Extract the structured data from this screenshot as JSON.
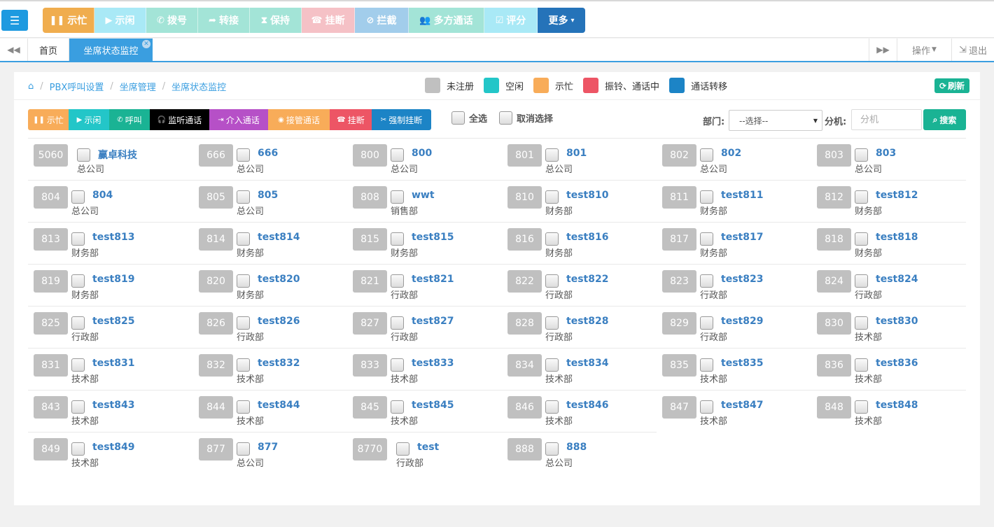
{
  "toolbar": {
    "buttons": [
      {
        "icon": "pause-icon",
        "glyph": "❚❚",
        "label": "示忙",
        "color": "#f0ad4e"
      },
      {
        "icon": "play-icon",
        "glyph": "▶",
        "label": "示闲",
        "color": "#a9e9f6"
      },
      {
        "icon": "phone-icon",
        "glyph": "✆",
        "label": "拨号",
        "color": "#a3e4d7"
      },
      {
        "icon": "share-icon",
        "glyph": "➦",
        "label": "转接",
        "color": "#a3e4d7"
      },
      {
        "icon": "hourglass-icon",
        "glyph": "⧗",
        "label": "保持",
        "color": "#a3e4d7"
      },
      {
        "icon": "hangup-icon",
        "glyph": "☎",
        "label": "挂断",
        "color": "#f5c1c6"
      },
      {
        "icon": "ban-icon",
        "glyph": "⊘",
        "label": "拦截",
        "color": "#a2cdeb"
      },
      {
        "icon": "users-icon",
        "glyph": "👥",
        "label": "多方通话",
        "color": "#a3e4d7"
      },
      {
        "icon": "check-square-icon",
        "glyph": "☑",
        "label": "评分",
        "color": "#a9e9f6"
      },
      {
        "icon": "caret-down-icon",
        "glyph": "▾",
        "label": "更多",
        "color": "#2573b9"
      }
    ]
  },
  "tabs": {
    "home": "首页",
    "active": "坐席状态监控",
    "ops": "操作",
    "exit": "退出"
  },
  "breadcrumb": [
    "PBX呼叫设置",
    "坐席管理",
    "坐席状态监控"
  ],
  "legend": [
    {
      "label": "未注册",
      "color": "#c0c0c0"
    },
    {
      "label": "空闲",
      "color": "#23c6c8"
    },
    {
      "label": "示忙",
      "color": "#f8ac59"
    },
    {
      "label": "振铃、通话中",
      "color": "#ed5565"
    },
    {
      "label": "通话转移",
      "color": "#1c84c6"
    }
  ],
  "refresh_label": "刷新",
  "actions": [
    {
      "icon": "pause-icon",
      "glyph": "❚❚",
      "label": "示忙",
      "color": "#f8ac59"
    },
    {
      "icon": "play-icon",
      "glyph": "▶",
      "label": "示闲",
      "color": "#23c6c8"
    },
    {
      "icon": "phone-icon",
      "glyph": "✆",
      "label": "呼叫",
      "color": "#1ab394"
    },
    {
      "icon": "headphones-icon",
      "glyph": "🎧",
      "label": "监听通话",
      "color": "#000000"
    },
    {
      "icon": "sign-in-icon",
      "glyph": "⇥",
      "label": "介入通话",
      "color": "#b650c7"
    },
    {
      "icon": "eye-icon",
      "glyph": "◉",
      "label": "接管通话",
      "color": "#f8ac59"
    },
    {
      "icon": "hangup-icon",
      "glyph": "☎",
      "label": "挂断",
      "color": "#ed5565"
    },
    {
      "icon": "scissors-icon",
      "glyph": "✂",
      "label": "强制挂断",
      "color": "#1c84c6"
    }
  ],
  "select_all": "全选",
  "deselect": "取消选择",
  "dept_label": "部门:",
  "dept_value": "--选择--",
  "ext_label": "分机:",
  "ext_placeholder": "分机",
  "search_label": "搜索",
  "agents": [
    {
      "ext": "5060",
      "name": "赢卓科技",
      "dept": "总公司"
    },
    {
      "ext": "666",
      "name": "666",
      "dept": "总公司"
    },
    {
      "ext": "800",
      "name": "800",
      "dept": "总公司"
    },
    {
      "ext": "801",
      "name": "801",
      "dept": "总公司"
    },
    {
      "ext": "802",
      "name": "802",
      "dept": "总公司"
    },
    {
      "ext": "803",
      "name": "803",
      "dept": "总公司"
    },
    {
      "ext": "804",
      "name": "804",
      "dept": "总公司"
    },
    {
      "ext": "805",
      "name": "805",
      "dept": "总公司"
    },
    {
      "ext": "808",
      "name": "wwt",
      "dept": "销售部"
    },
    {
      "ext": "810",
      "name": "test810",
      "dept": "财务部"
    },
    {
      "ext": "811",
      "name": "test811",
      "dept": "财务部"
    },
    {
      "ext": "812",
      "name": "test812",
      "dept": "财务部"
    },
    {
      "ext": "813",
      "name": "test813",
      "dept": "财务部"
    },
    {
      "ext": "814",
      "name": "test814",
      "dept": "财务部"
    },
    {
      "ext": "815",
      "name": "test815",
      "dept": "财务部"
    },
    {
      "ext": "816",
      "name": "test816",
      "dept": "财务部"
    },
    {
      "ext": "817",
      "name": "test817",
      "dept": "财务部"
    },
    {
      "ext": "818",
      "name": "test818",
      "dept": "财务部"
    },
    {
      "ext": "819",
      "name": "test819",
      "dept": "财务部"
    },
    {
      "ext": "820",
      "name": "test820",
      "dept": "财务部"
    },
    {
      "ext": "821",
      "name": "test821",
      "dept": "行政部"
    },
    {
      "ext": "822",
      "name": "test822",
      "dept": "行政部"
    },
    {
      "ext": "823",
      "name": "test823",
      "dept": "行政部"
    },
    {
      "ext": "824",
      "name": "test824",
      "dept": "行政部"
    },
    {
      "ext": "825",
      "name": "test825",
      "dept": "行政部"
    },
    {
      "ext": "826",
      "name": "test826",
      "dept": "行政部"
    },
    {
      "ext": "827",
      "name": "test827",
      "dept": "行政部"
    },
    {
      "ext": "828",
      "name": "test828",
      "dept": "行政部"
    },
    {
      "ext": "829",
      "name": "test829",
      "dept": "行政部"
    },
    {
      "ext": "830",
      "name": "test830",
      "dept": "技术部"
    },
    {
      "ext": "831",
      "name": "test831",
      "dept": "技术部"
    },
    {
      "ext": "832",
      "name": "test832",
      "dept": "技术部"
    },
    {
      "ext": "833",
      "name": "test833",
      "dept": "技术部"
    },
    {
      "ext": "834",
      "name": "test834",
      "dept": "技术部"
    },
    {
      "ext": "835",
      "name": "test835",
      "dept": "技术部"
    },
    {
      "ext": "836",
      "name": "test836",
      "dept": "技术部"
    },
    {
      "ext": "843",
      "name": "test843",
      "dept": "技术部"
    },
    {
      "ext": "844",
      "name": "test844",
      "dept": "技术部"
    },
    {
      "ext": "845",
      "name": "test845",
      "dept": "技术部"
    },
    {
      "ext": "846",
      "name": "test846",
      "dept": "技术部"
    },
    {
      "ext": "847",
      "name": "test847",
      "dept": "技术部"
    },
    {
      "ext": "848",
      "name": "test848",
      "dept": "技术部"
    },
    {
      "ext": "849",
      "name": "test849",
      "dept": "技术部"
    },
    {
      "ext": "877",
      "name": "877",
      "dept": "总公司"
    },
    {
      "ext": "8770",
      "name": "test",
      "dept": "行政部"
    },
    {
      "ext": "888",
      "name": "888",
      "dept": "总公司"
    }
  ]
}
